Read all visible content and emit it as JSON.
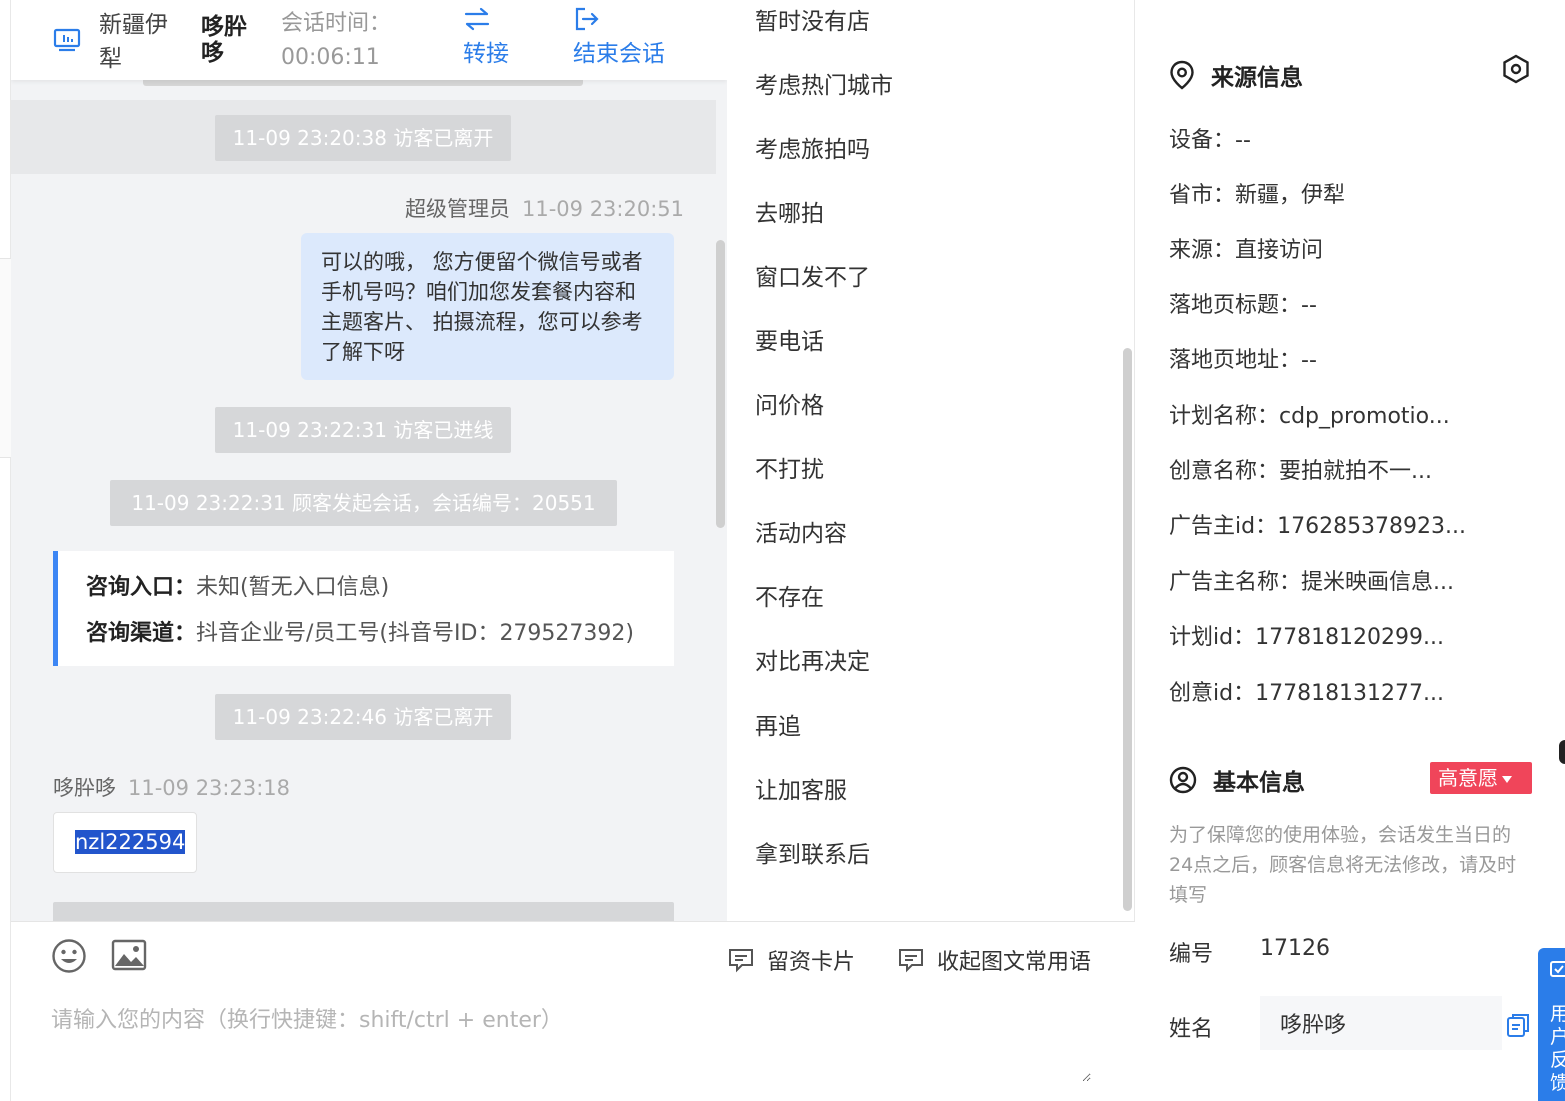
{
  "chat_header": {
    "location": "新疆伊犁",
    "visitor_name": "哆肸哆",
    "time_label": "会话时间：",
    "duration": "00:06:11",
    "transfer_label": "转接",
    "end_label": "结束会话"
  },
  "messages": {
    "sys_left_1": "11-09 23:20:38 访客已离开",
    "agent_name": "超级管理员",
    "agent_time": "11-09 23:20:51",
    "agent_text": "可以的哦， 您方便留个微信号或者手机号吗？咱们加您发套餐内容和主题客片、 拍摄流程，您可以参考了解下呀",
    "sys_enter": "11-09 23:22:31 访客已进线",
    "sys_session": "11-09 23:22:31 顾客发起会话，会话编号：20551",
    "entry_label": "咨询入口：",
    "entry_value": "未知(暂无入口信息)",
    "channel_label": "咨询渠道：",
    "channel_value": "抖音企业号/员工号(抖音号ID：279527392)",
    "sys_left_2": "11-09 23:22:46 访客已离开",
    "visitor_name": "哆肸哆",
    "visitor_time": "11-09 23:23:18",
    "visitor_text": "nzl222594"
  },
  "quick_replies": [
    "暂时没有店",
    "考虑热门城市",
    "考虑旅拍吗",
    "去哪拍",
    "窗口发不了",
    "要电话",
    "问价格",
    "不打扰",
    "活动内容",
    "不存在",
    "对比再决定",
    "再追",
    "让加客服",
    "拿到联系后"
  ],
  "input": {
    "card_label": "留资卡片",
    "common_label": "收起图文常用语",
    "placeholder": "请输入您的内容（换行快捷键：shift/ctrl + enter）"
  },
  "source_info": {
    "title": "来源信息",
    "device": "设备：--",
    "region": "省市：新疆，伊犁",
    "source": "来源：直接访问",
    "landing_title": "落地页标题：--",
    "landing_url": "落地页地址：--",
    "plan_name": "计划名称：cdp_promotio...",
    "creative_name": "创意名称：要拍就拍不一...",
    "advertiser_id": "广告主id：176285378923...",
    "advertiser_name": "广告主名称：提米映画信息...",
    "plan_id": "计划id：177818120299...",
    "creative_id": "创意id：177818131277..."
  },
  "basic_info": {
    "title": "基本信息",
    "intent_badge": "高意愿",
    "notice": "为了保障您的使用体验，会话发生当日的24点之后，顾客信息将无法修改，请及时填写",
    "id_label": "编号",
    "id_value": "17126",
    "name_label": "姓名",
    "name_value": "哆肸哆"
  },
  "feedback": {
    "label": "用户反馈"
  },
  "colors": {
    "accent": "#2b7de9",
    "badge": "#f0455a",
    "agent_bubble": "#dce9fc",
    "system_msg": "#d6d7d9"
  }
}
